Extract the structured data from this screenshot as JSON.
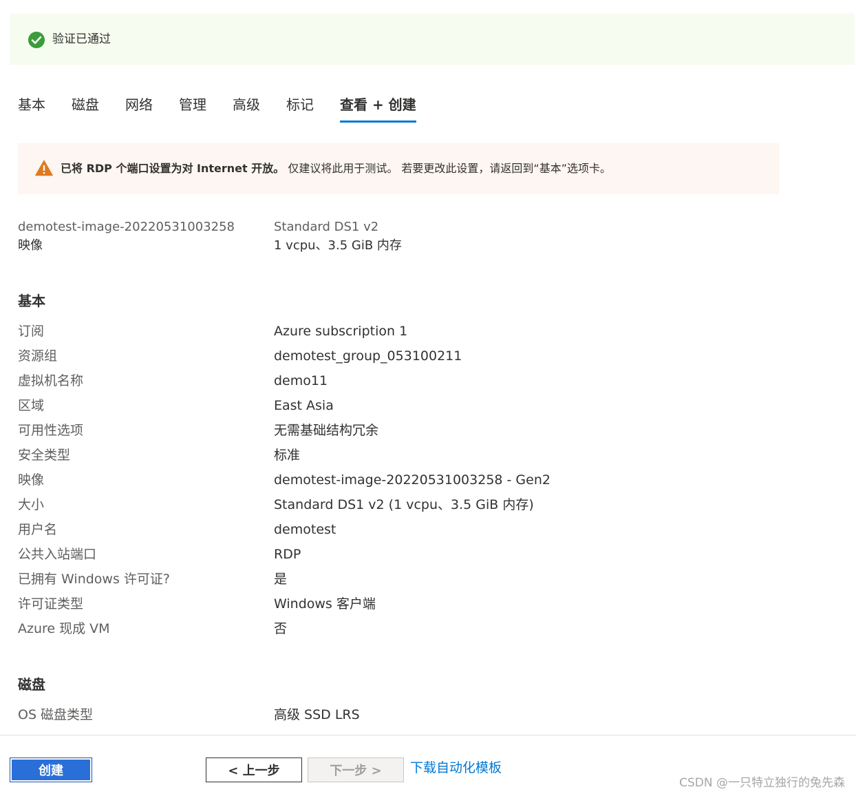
{
  "validation": {
    "text": "验证已通过",
    "color": "#2e8b2e"
  },
  "tabs": [
    {
      "label": "基本",
      "active": false
    },
    {
      "label": "磁盘",
      "active": false
    },
    {
      "label": "网络",
      "active": false
    },
    {
      "label": "管理",
      "active": false
    },
    {
      "label": "高级",
      "active": false
    },
    {
      "label": "标记",
      "active": false
    },
    {
      "label": "查看 + 创建",
      "active": true
    }
  ],
  "warning": {
    "bold_text": "已将 RDP 个端口设置为对 Internet 开放。",
    "text": " 仅建议将此用于测试。 若要更改此设置，请返回到“基本”选项卡。"
  },
  "summary": {
    "image_name": "demotest-image-20220531003258",
    "image_label": "映像",
    "size_name": "Standard DS1 v2",
    "size_detail": "1 vcpu、3.5 GiB 内存"
  },
  "basics": {
    "title": "基本",
    "rows": [
      {
        "label": "订阅",
        "value": "Azure subscription 1"
      },
      {
        "label": "资源组",
        "value": "demotest_group_053100211"
      },
      {
        "label": "虚拟机名称",
        "value": "demo11"
      },
      {
        "label": "区域",
        "value": "East Asia"
      },
      {
        "label": "可用性选项",
        "value": "无需基础结构冗余"
      },
      {
        "label": "安全类型",
        "value": "标准"
      },
      {
        "label": "映像",
        "value": "demotest-image-20220531003258 - Gen2"
      },
      {
        "label": "大小",
        "value": "Standard DS1 v2 (1 vcpu、3.5 GiB 内存)"
      },
      {
        "label": "用户名",
        "value": "demotest"
      },
      {
        "label": "公共入站端口",
        "value": "RDP"
      },
      {
        "label": "已拥有 Windows 许可证?",
        "value": "是"
      },
      {
        "label": "许可证类型",
        "value": "Windows 客户端"
      },
      {
        "label": "Azure 现成 VM",
        "value": "否"
      }
    ]
  },
  "disks": {
    "title": "磁盘",
    "rows": [
      {
        "label": "OS 磁盘类型",
        "value": "高级 SSD LRS"
      }
    ]
  },
  "footer": {
    "create_label": "创建",
    "prev_label": "< 上一步",
    "next_label": "下一步 >",
    "download_label": "下载自动化模板"
  },
  "watermark": "CSDN @一只特立独行的兔先森"
}
